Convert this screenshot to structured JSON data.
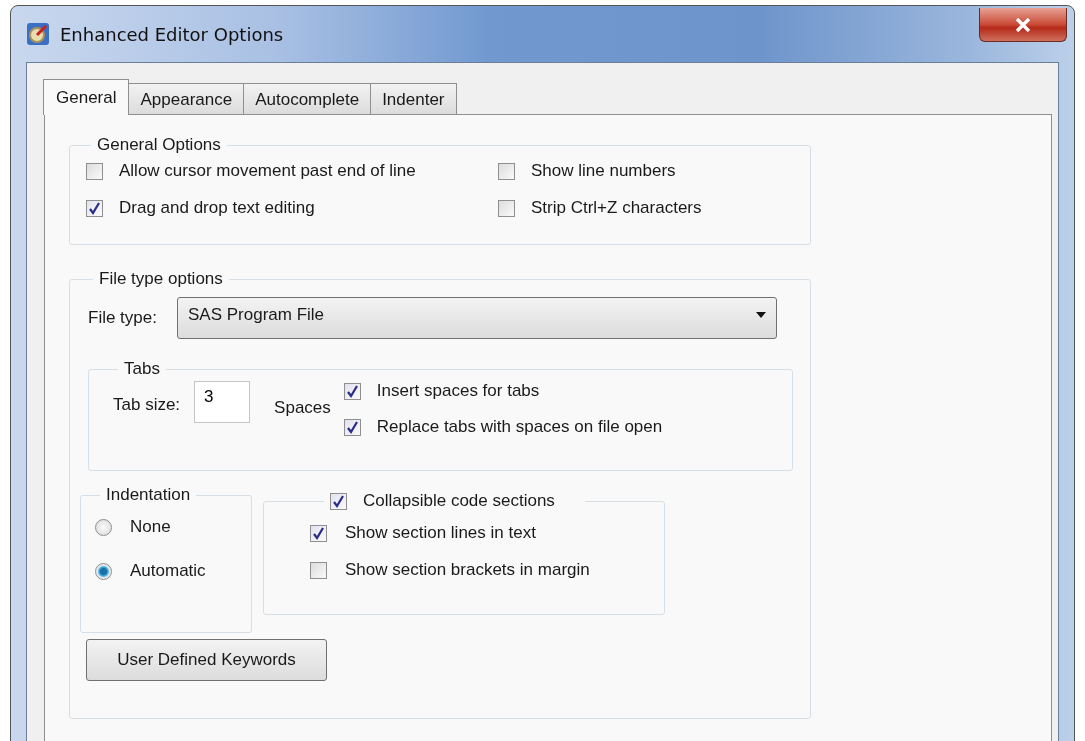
{
  "window": {
    "title": "Enhanced Editor Options"
  },
  "tabs": [
    {
      "label": "General",
      "selected": true
    },
    {
      "label": "Appearance",
      "selected": false
    },
    {
      "label": "Autocomplete",
      "selected": false
    },
    {
      "label": "Indenter",
      "selected": false
    }
  ],
  "general_options": {
    "title": "General Options",
    "checkboxes": [
      {
        "label": "Allow cursor movement past end of line",
        "checked": false
      },
      {
        "label": "Show line numbers",
        "checked": false
      },
      {
        "label": "Drag and drop text editing",
        "checked": true
      },
      {
        "label": "Strip Ctrl+Z characters",
        "checked": false
      }
    ]
  },
  "file_type_options": {
    "title": "File type options",
    "file_type": {
      "label": "File type:",
      "value": "SAS Program File"
    },
    "tabs_group": {
      "title": "Tabs",
      "tab_size": {
        "label": "Tab size:",
        "value": "3"
      },
      "units": "Spaces",
      "checkboxes": [
        {
          "label": "Insert spaces for tabs",
          "checked": true
        },
        {
          "label": "Replace tabs with spaces on file open",
          "checked": true
        }
      ]
    },
    "indentation": {
      "title": "Indentation",
      "options": [
        {
          "label": "None",
          "selected": false
        },
        {
          "label": "Automatic",
          "selected": true
        }
      ]
    },
    "collapsible": {
      "label": "Collapsible code sections",
      "checked": true,
      "checkboxes": [
        {
          "label": "Show section lines in text",
          "checked": true
        },
        {
          "label": "Show section brackets in margin",
          "checked": false
        }
      ]
    },
    "button": "User Defined Keywords"
  }
}
